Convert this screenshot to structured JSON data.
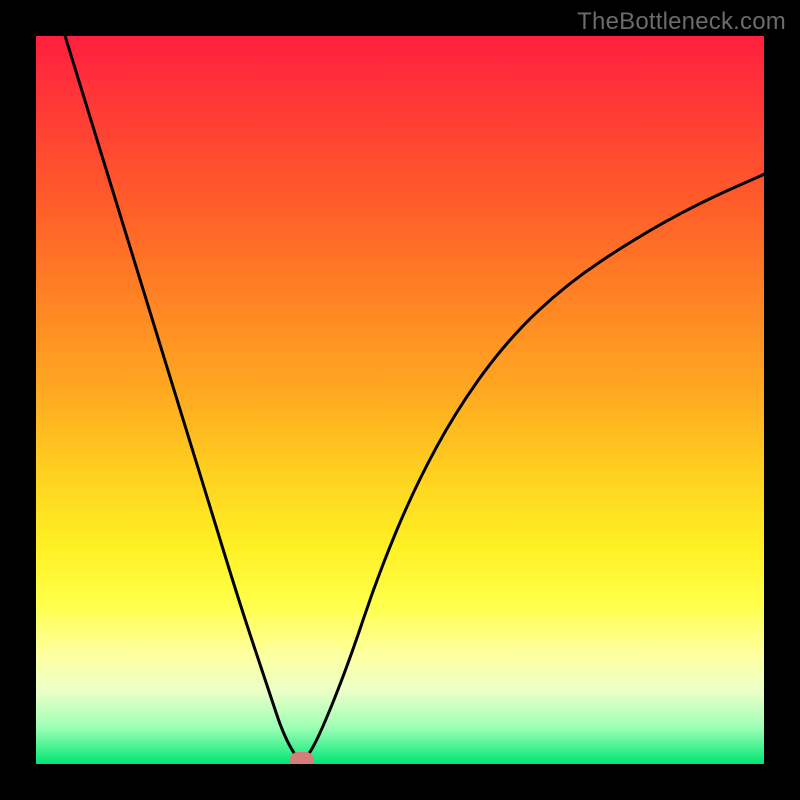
{
  "watermark": "TheBottleneck.com",
  "chart_data": {
    "type": "line",
    "title": "",
    "xlabel": "",
    "ylabel": "",
    "xlim": [
      0,
      100
    ],
    "ylim": [
      0,
      100
    ],
    "series": [
      {
        "name": "bottleneck-curve",
        "x": [
          4,
          8,
          12,
          16,
          20,
          24,
          28,
          32,
          34,
          36,
          37,
          39,
          43,
          47,
          52,
          58,
          65,
          73,
          82,
          91,
          100
        ],
        "y": [
          100,
          87,
          74,
          61,
          48,
          35,
          22,
          10,
          4,
          0.5,
          0.5,
          4,
          14,
          26,
          38,
          49,
          58.5,
          66,
          72,
          77,
          81
        ]
      }
    ],
    "marker": {
      "x": 36.5,
      "y": 0.5,
      "color": "#d47d7a"
    },
    "background_gradient": {
      "stops": [
        {
          "pct": 0,
          "color": "#ff1f3e"
        },
        {
          "pct": 10,
          "color": "#ff3a36"
        },
        {
          "pct": 22,
          "color": "#ff5a2a"
        },
        {
          "pct": 35,
          "color": "#ff8024"
        },
        {
          "pct": 48,
          "color": "#ffa621"
        },
        {
          "pct": 60,
          "color": "#ffd020"
        },
        {
          "pct": 70,
          "color": "#fff023"
        },
        {
          "pct": 78,
          "color": "#ffff4a"
        },
        {
          "pct": 85,
          "color": "#fdffa0"
        },
        {
          "pct": 90,
          "color": "#ecffc8"
        },
        {
          "pct": 95,
          "color": "#9cffb4"
        },
        {
          "pct": 100,
          "color": "#00e676"
        }
      ]
    }
  }
}
